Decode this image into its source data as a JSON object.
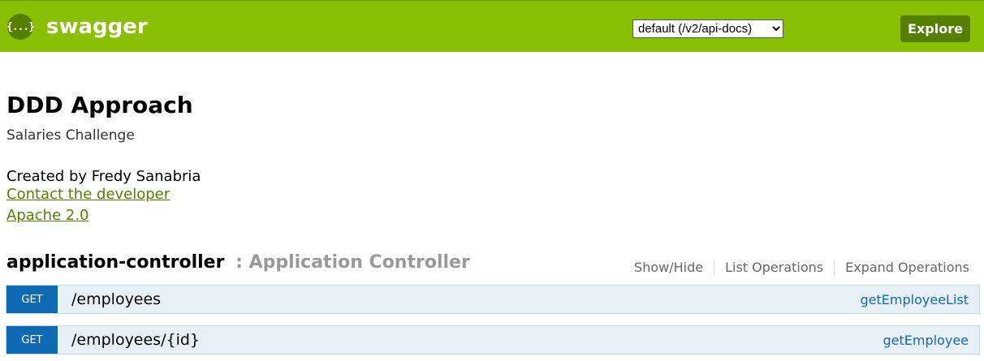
{
  "header": {
    "logo_icon": "{...}",
    "logo_text": "swagger",
    "spec_select": {
      "selected": "default (/v2/api-docs)",
      "options": [
        "default (/v2/api-docs)"
      ]
    },
    "explore_label": "Explore",
    "colors": {
      "bar": "#89bf04",
      "button": "#547f00"
    }
  },
  "info": {
    "title": "DDD Approach",
    "description": "Salaries Challenge",
    "created_by": "Created by Fredy Sanabria",
    "contact_link": "Contact the developer",
    "license_link": "Apache 2.0"
  },
  "resource": {
    "name": "application-controller",
    "separator": " : ",
    "description": "Application Controller",
    "options": {
      "show_hide": "Show/Hide",
      "list_operations": "List Operations",
      "expand_operations": "Expand Operations"
    }
  },
  "operations": [
    {
      "method": "GET",
      "path": "/employees",
      "nickname": "getEmployeeList"
    },
    {
      "method": "GET",
      "path": "/employees/{id}",
      "nickname": "getEmployee"
    }
  ],
  "icons": {
    "logo": "swagger-braces-icon",
    "dropdown": "chevron-down-icon"
  }
}
